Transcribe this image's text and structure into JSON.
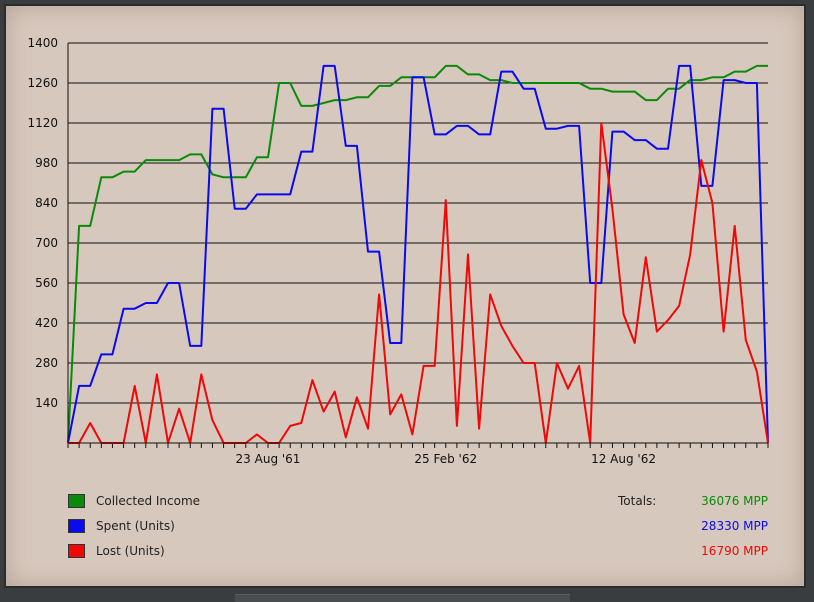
{
  "chart_data": {
    "type": "line",
    "title": "",
    "xlabel": "",
    "ylabel": "",
    "ylim": [
      0,
      1400
    ],
    "yticks": [
      140,
      280,
      420,
      560,
      700,
      840,
      980,
      1120,
      1260,
      1400
    ],
    "n_points": 64,
    "x_tick_labels": [
      {
        "label": "23 Aug '61",
        "index": 18
      },
      {
        "label": "25 Feb '62",
        "index": 34
      },
      {
        "label": "12 Aug '62",
        "index": 50
      }
    ],
    "grid": true,
    "legend_position": "bottom-left",
    "series": [
      {
        "name": "Collected Income",
        "color": "#0a8a0a",
        "values": [
          0,
          760,
          760,
          930,
          930,
          950,
          950,
          990,
          990,
          990,
          990,
          1010,
          1010,
          940,
          930,
          930,
          930,
          1000,
          1000,
          1260,
          1260,
          1180,
          1180,
          1190,
          1200,
          1200,
          1210,
          1210,
          1250,
          1250,
          1280,
          1280,
          1280,
          1280,
          1320,
          1320,
          1290,
          1290,
          1270,
          1270,
          1260,
          1260,
          1260,
          1260,
          1260,
          1260,
          1260,
          1240,
          1240,
          1230,
          1230,
          1230,
          1200,
          1200,
          1240,
          1240,
          1270,
          1270,
          1280,
          1280,
          1300,
          1300,
          1320,
          1320
        ]
      },
      {
        "name": "Spent (Units)",
        "color": "#0a0aee",
        "values": [
          0,
          200,
          200,
          310,
          310,
          470,
          470,
          490,
          490,
          560,
          560,
          340,
          340,
          1170,
          1170,
          820,
          820,
          870,
          870,
          870,
          870,
          1020,
          1020,
          1320,
          1320,
          1040,
          1040,
          670,
          670,
          350,
          350,
          1280,
          1280,
          1080,
          1080,
          1110,
          1110,
          1080,
          1080,
          1300,
          1300,
          1240,
          1240,
          1100,
          1100,
          1110,
          1110,
          560,
          560,
          1090,
          1090,
          1060,
          1060,
          1030,
          1030,
          1320,
          1320,
          900,
          900,
          1270,
          1270,
          1260,
          1260,
          0
        ]
      },
      {
        "name": "Lost (Units)",
        "color": "#ee0808",
        "values": [
          0,
          0,
          70,
          0,
          0,
          0,
          200,
          0,
          240,
          0,
          120,
          0,
          240,
          80,
          0,
          0,
          0,
          30,
          0,
          0,
          60,
          70,
          220,
          110,
          180,
          20,
          160,
          50,
          520,
          100,
          170,
          30,
          270,
          270,
          850,
          60,
          660,
          50,
          520,
          410,
          340,
          280,
          280,
          0,
          280,
          190,
          270,
          0,
          1120,
          820,
          450,
          350,
          650,
          390,
          430,
          480,
          660,
          990,
          840,
          390,
          760,
          360,
          250,
          0
        ]
      }
    ],
    "totals": {
      "label": "Totals:",
      "values": [
        "36076 MPP",
        "28330 MPP",
        "16790 MPP"
      ]
    }
  }
}
